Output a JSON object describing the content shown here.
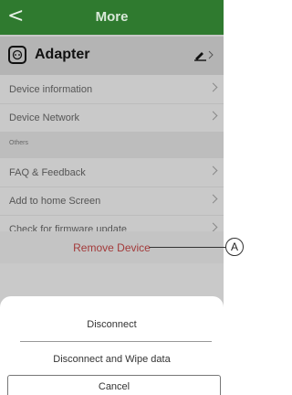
{
  "header": {
    "back_glyph": "<",
    "title": "More"
  },
  "device": {
    "name": "Adapter",
    "icon": "adapter-icon",
    "edit_icon": "edit-pencil-icon"
  },
  "menu": {
    "device_information": "Device information",
    "device_network": "Device Network",
    "section_others": "Others",
    "faq": "FAQ & Feedback",
    "add_home": "Add to home Screen",
    "firmware": "Check for firmware update"
  },
  "remove": {
    "label": "Remove Device"
  },
  "sheet": {
    "disconnect": "Disconnect",
    "disconnect_wipe": "Disconnect and Wipe data",
    "cancel": "Cancel"
  },
  "callout": {
    "label": "A"
  },
  "colors": {
    "header_bg": "#2f7a2f",
    "remove_text": "#a33a3a",
    "overlay": "#c9c9c9"
  }
}
